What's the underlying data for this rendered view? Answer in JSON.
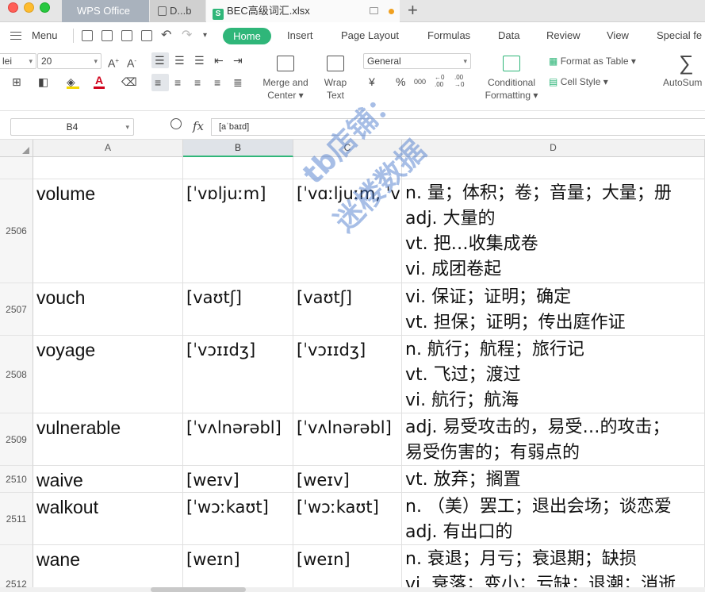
{
  "titlebar": {
    "tabs": [
      {
        "label": "WPS Office"
      },
      {
        "label": "D...b"
      },
      {
        "label": "BEC高级词汇.xlsx",
        "icon": "S"
      }
    ],
    "new_tab_label": "+"
  },
  "menu": {
    "hamburger_label": "Menu",
    "items": [
      "Home",
      "Insert",
      "Page Layout",
      "Formulas",
      "Data",
      "Review",
      "View",
      "Special fe"
    ]
  },
  "ribbon": {
    "font_name": "lei",
    "font_size": "20",
    "merge_label_1": "Merge and",
    "merge_label_2": "Center",
    "wrap_label_1": "Wrap",
    "wrap_label_2": "Text",
    "number_format": "General",
    "currency_symbol": "¥",
    "percent_symbol": "%",
    "thousands_symbol": "000",
    "dec_inc": "←0\n.00",
    "dec_dec": ".00\n→0",
    "conditional_label_1": "Conditional",
    "conditional_label_2": "Formatting",
    "format_as_table": "Format as Table",
    "cell_style": "Cell Style",
    "autosum": "AutoSum",
    "font_color": "#d0021b",
    "highlight_color": "#f5d800",
    "accent_color": "#2fb679"
  },
  "formula_bar": {
    "name_box": "B4",
    "fx_label": "fx",
    "formula": "[aˈbaɪd]"
  },
  "columns": [
    "A",
    "B",
    "C",
    "D"
  ],
  "rows": [
    {
      "num": "",
      "a": "",
      "b": "",
      "c": "",
      "d": []
    },
    {
      "num": "2506",
      "a": "volume",
      "b": "[ˈvɒljuːm]",
      "c": "[ˈvɑːljuːm, ˈv",
      "d": [
        "n. 量；体积；卷；音量；大量；册",
        "adj. 大量的",
        "vt. 把…收集成卷",
        "vi. 成团卷起"
      ]
    },
    {
      "num": "2507",
      "a": "vouch",
      "b": "[vaʊtʃ]",
      "c": "[vaʊtʃ]",
      "d": [
        "vi. 保证；证明；确定",
        "vt. 担保；证明；传出庭作证"
      ]
    },
    {
      "num": "2508",
      "a": "voyage",
      "b": "[ˈvɔɪɪdʒ]",
      "c": "[ˈvɔɪɪdʒ]",
      "d": [
        "n. 航行；航程；旅行记",
        "vt. 飞过；渡过",
        "vi. 航行；航海"
      ]
    },
    {
      "num": "2509",
      "a": "vulnerable",
      "b": "[ˈvʌlnərəbl]",
      "c": "[ˈvʌlnərəbl]",
      "d": [
        "adj. 易受攻击的，易受…的攻击；",
        "易受伤害的；有弱点的"
      ]
    },
    {
      "num": "2510",
      "a": "waive",
      "b": "[weɪv]",
      "c": "[weɪv]",
      "d": [
        "vt. 放弃；搁置"
      ]
    },
    {
      "num": "2511",
      "a": "walkout",
      "b": "[ˈwɔːkaʊt]",
      "c": "[ˈwɔːkaʊt]",
      "d": [
        "n. （美）罢工；退出会场；谈恋爱",
        "adj. 有出口的"
      ]
    },
    {
      "num": "2512",
      "a": "wane",
      "b": "[weɪn]",
      "c": "[weɪn]",
      "d": [
        "n. 衰退；月亏；衰退期；缺损",
        "vi. 衰落；变小；亏缺；退潮；消逝"
      ]
    }
  ],
  "watermark": {
    "line1": "tb店铺：",
    "line2": "迷楼数据"
  }
}
